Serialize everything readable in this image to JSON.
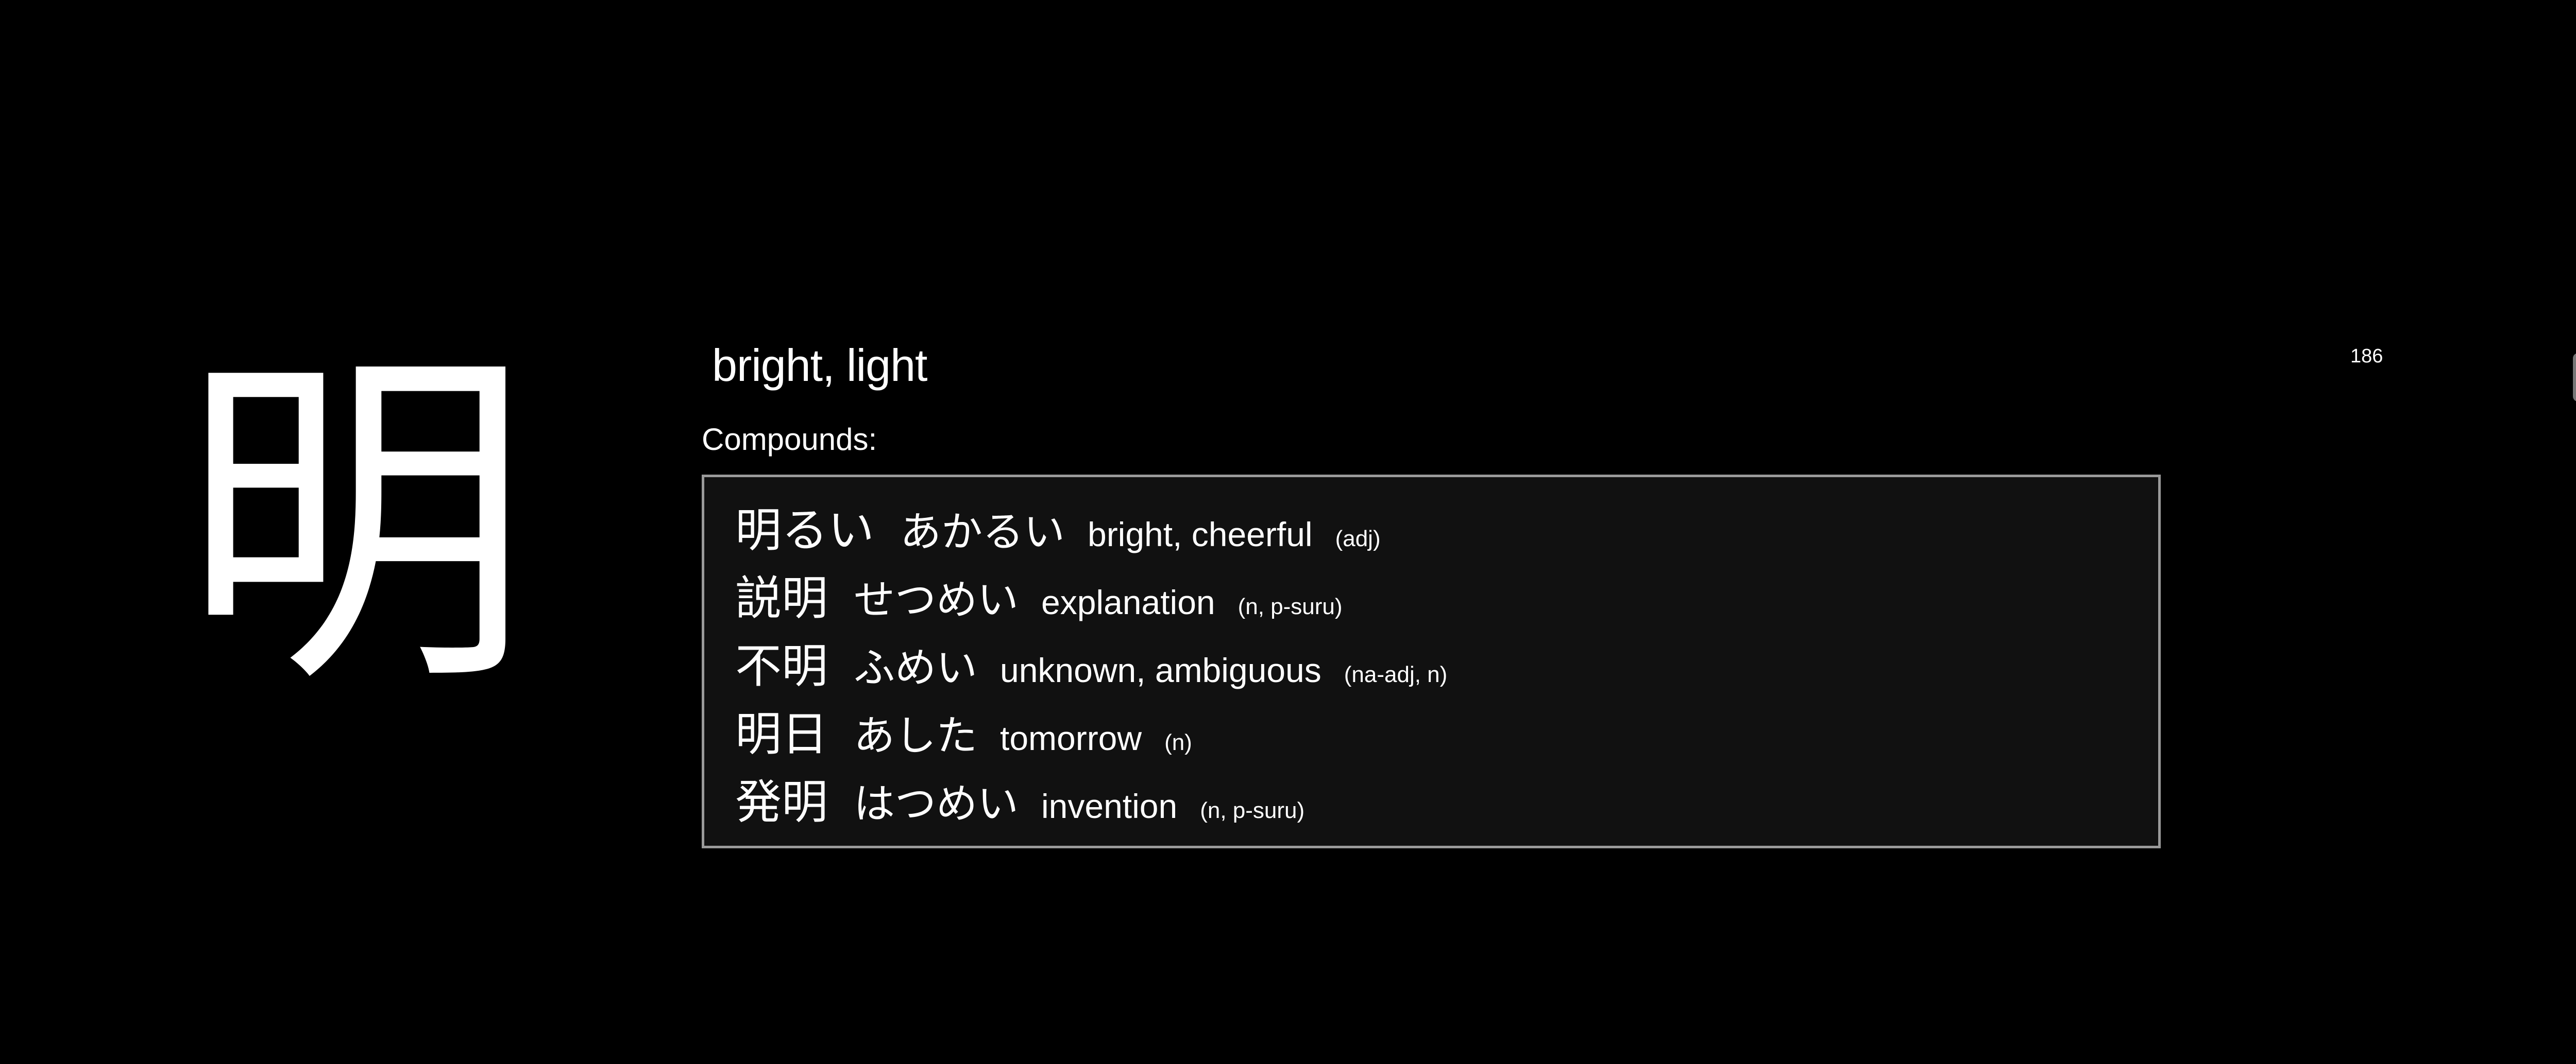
{
  "kanji": "明",
  "meaning": "bright, light",
  "counter": "186",
  "compounds_label": "Compounds:",
  "compounds": [
    {
      "word": "明るい",
      "reading": "あかるい",
      "gloss": "bright, cheerful",
      "pos": "(adj)"
    },
    {
      "word": "説明",
      "reading": "せつめい",
      "gloss": "explanation",
      "pos": "(n, p-suru)"
    },
    {
      "word": "不明",
      "reading": "ふめい",
      "gloss": "unknown, ambiguous",
      "pos": "(na-adj, n)"
    },
    {
      "word": "明日",
      "reading": "あした",
      "gloss": "tomorrow",
      "pos": "(n)"
    },
    {
      "word": "発明",
      "reading": "はつめい",
      "gloss": "invention",
      "pos": "(n, p-suru)"
    }
  ],
  "colors": {
    "background": "#000000",
    "text": "#ffffff",
    "box_background": "#111111",
    "box_border": "#9a9a9a"
  }
}
